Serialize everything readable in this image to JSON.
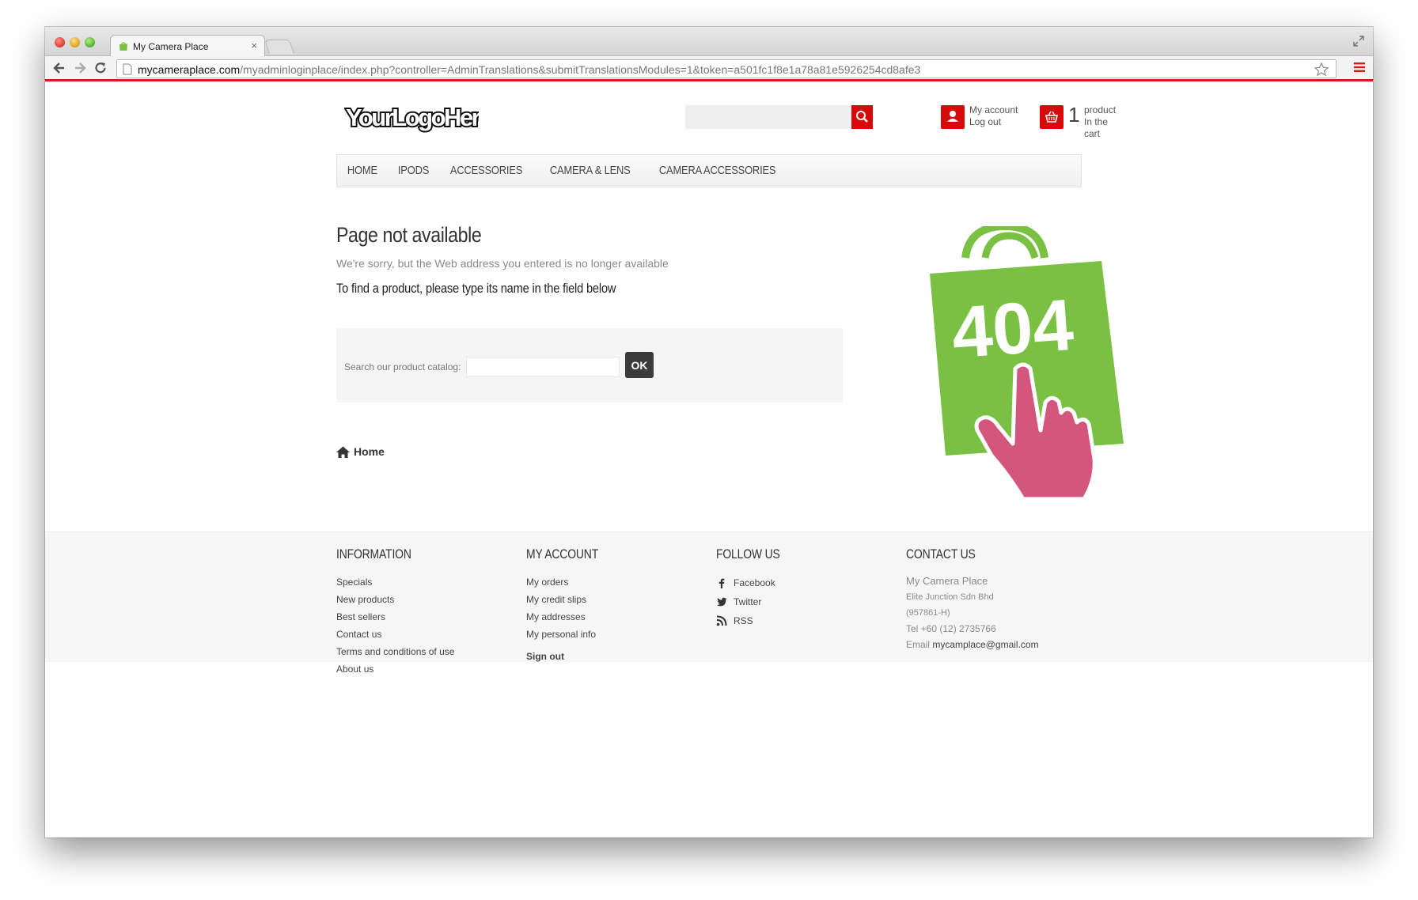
{
  "browser": {
    "tab_title": "My Camera Place",
    "tab_close": "×",
    "url_host": "mycameraplace.com",
    "url_path": "/myadminloginplace/index.php?controller=AdminTranslations&submitTranslationsModules=1&token=a501fc1f8e1a78a81e5926254cd8afe3"
  },
  "header": {
    "logo_text": "YourLogoHere",
    "account": {
      "line1": "My account",
      "line2": "Log out"
    },
    "cart": {
      "count": "1",
      "line1": "product",
      "line2": "In the cart"
    }
  },
  "menu": [
    "HOME",
    "IPODS",
    "ACCESSORIES",
    "CAMERA & LENS",
    "CAMERA ACCESSORIES"
  ],
  "main": {
    "title": "Page not available",
    "sorry": "We're sorry, but the Web address you entered is no longer available",
    "hint": "To find a product, please type its name in the field below",
    "catalog_label": "Search our product catalog:",
    "ok_label": "OK",
    "home_label": "Home",
    "badge_404": "404"
  },
  "footer": {
    "information": {
      "title": "INFORMATION",
      "links": [
        "Specials",
        "New products",
        "Best sellers",
        "Contact us",
        "Terms and conditions of use",
        "About us"
      ]
    },
    "my_account": {
      "title": "MY ACCOUNT",
      "links": [
        "My orders",
        "My credit slips",
        "My addresses",
        "My personal info"
      ],
      "signout": "Sign out"
    },
    "follow_us": {
      "title": "FOLLOW US",
      "links": [
        "Facebook",
        "Twitter",
        "RSS"
      ]
    },
    "contact_us": {
      "title": "CONTACT US",
      "name": "My Camera Place",
      "company": "Elite Junction Sdn Bhd",
      "reg": "(957861-H)",
      "tel": "Tel +60 (12) 2735766",
      "email_label": "Email",
      "email": "mycamplace@gmail.com"
    }
  },
  "colors": {
    "accent_red": "#d60a0a",
    "bag_green": "#7ac143",
    "hand_pink": "#d4567f"
  }
}
